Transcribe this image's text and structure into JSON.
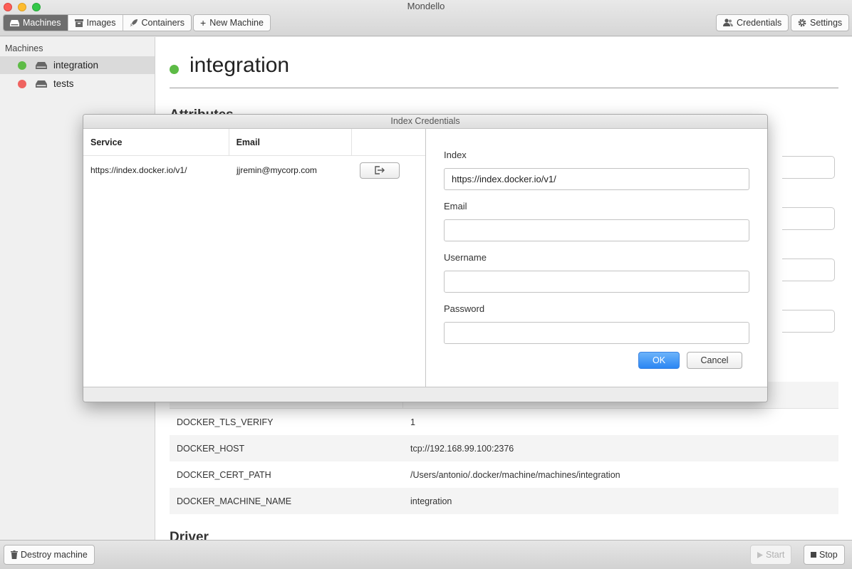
{
  "window": {
    "title": "Mondello"
  },
  "toolbar": {
    "tabs": [
      {
        "label": "Machines",
        "icon": "drive-icon",
        "active": true
      },
      {
        "label": "Images",
        "icon": "box-icon",
        "active": false
      },
      {
        "label": "Containers",
        "icon": "rocket-icon",
        "active": false
      }
    ],
    "new_machine_label": "New Machine",
    "credentials_label": "Credentials",
    "settings_label": "Settings"
  },
  "sidebar": {
    "heading": "Machines",
    "items": [
      {
        "label": "integration",
        "status": "running",
        "status_color": "#5dbb46",
        "selected": true
      },
      {
        "label": "tests",
        "status": "stopped",
        "status_color": "#ef6360",
        "selected": false
      }
    ]
  },
  "main": {
    "title": "integration",
    "sections": {
      "attributes": "Attributes",
      "driver": "Driver"
    },
    "environment": [
      {
        "key": "DOCKER_TLS_VERIFY",
        "value": "1"
      },
      {
        "key": "DOCKER_HOST",
        "value": "tcp://192.168.99.100:2376"
      },
      {
        "key": "DOCKER_CERT_PATH",
        "value": "/Users/antonio/.docker/machine/machines/integration"
      },
      {
        "key": "DOCKER_MACHINE_NAME",
        "value": "integration"
      }
    ]
  },
  "dialog": {
    "title": "Index Credentials",
    "columns": {
      "service": "Service",
      "email": "Email"
    },
    "rows": [
      {
        "service": "https://index.docker.io/v1/",
        "email": "jjremin@mycorp.com",
        "action_icon": "logout-icon"
      }
    ],
    "form": {
      "index_label": "Index",
      "index_value": "https://index.docker.io/v1/",
      "email_label": "Email",
      "email_value": "",
      "username_label": "Username",
      "username_value": "",
      "password_label": "Password",
      "password_value": "",
      "ok_label": "OK",
      "cancel_label": "Cancel"
    }
  },
  "bottombar": {
    "destroy_label": "Destroy machine",
    "start_label": "Start",
    "stop_label": "Stop"
  },
  "colors": {
    "accent": "#2a86f3",
    "running": "#5dbb46",
    "stopped": "#ef6360"
  }
}
